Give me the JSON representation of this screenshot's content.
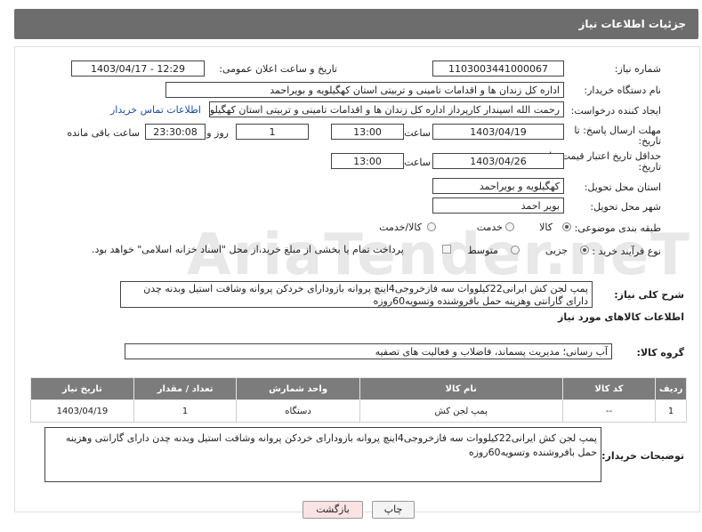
{
  "header": {
    "title": "جزئیات اطلاعات نیاز"
  },
  "form": {
    "need_number_label": "شماره نیاز:",
    "need_number": "1103003441000067",
    "announce_label": "تاریخ و ساعت اعلان عمومی:",
    "announce_value": "1403/04/17 - 12:29",
    "buyer_org_label": "نام دستگاه خریدار:",
    "buyer_org": "اداره کل زندان ها و اقدامات تامینی و تربیتی استان کهگیلویه و بویراحمد",
    "requester_label": "ایجاد کننده درخواست:",
    "requester": "رحمت الله اسپندار کارپرداز اداره کل زندان ها و اقدامات تامینی و تربیتی استان کهگیلویه و بویراحمد",
    "contact_link": "اطلاعات تماس خریدار",
    "reply_deadline_label": "مهلت ارسال پاسخ: تا",
    "reply_deadline_label2": "تاریخ:",
    "reply_date": "1403/04/19",
    "time_label": "ساعت",
    "reply_time": "13:00",
    "days_value": "1",
    "days_label": "روز و",
    "remaining_value": "23:30:08",
    "remaining_label": "ساعت باقی مانده",
    "validity_label": "حداقل تاریخ اعتبار قیمت: تا",
    "validity_label2": "تاریخ:",
    "validity_date": "1403/04/26",
    "validity_time": "13:00",
    "province_label": "استان محل تحویل:",
    "province": "کهگیلویه و بویراحمد",
    "city_label": "شهر محل تحویل:",
    "city": "بویر احمد",
    "category_label": "طبقه بندی موضوعی:",
    "cat_goods": "کالا",
    "cat_service": "خدمت",
    "cat_goods_service": "کالا/خدمت",
    "process_label": "نوع فرآیند خرید :",
    "proc_minor": "جزیی",
    "proc_medium": "متوسط",
    "payment_note": "پرداخت تمام یا بخشی از مبلغ خرید،از محل \"اسناد خزانه اسلامی\" خواهد بود."
  },
  "summary": {
    "label": "شرح کلی نیاز:",
    "text": "پمپ لجن کش ایرانی22کیلووات سه فازخروجی4اینچ پروانه بازودارای خردکن پروانه وشافت استیل وبدنه چدن دارای گارانتی وهزینه حمل بافروشنده وتسویه60روزه"
  },
  "goods": {
    "section_title": "اطلاعات کالاهای مورد نیاز",
    "group_label": "گروه کالا:",
    "group_value": "آب رسانی؛ مدیریت پسماند، فاضلاب و فعالیت های تصفیه",
    "columns": [
      "ردیف",
      "کد کالا",
      "نام کالا",
      "واحد شمارش",
      "تعداد / مقدار",
      "تاریخ نیاز"
    ],
    "rows": [
      {
        "row": "1",
        "code": "--",
        "name": "پمپ لجن کش",
        "unit": "دستگاه",
        "qty": "1",
        "date": "1403/04/19"
      }
    ]
  },
  "buyer_notes": {
    "label": "توضیحات خریدار:",
    "text": "پمپ لجن کش ایرانی22کیلووات سه فازخروجی4اینچ پروانه بازودارای خردکن پروانه وشافت استیل وبدنه چدن دارای گارانتی وهزینه حمل بافروشنده وتسویه60روزه"
  },
  "buttons": {
    "print": "چاپ",
    "back": "بازگشت"
  },
  "watermark": "AriaTender.neT",
  "colors": {
    "header_bg": "#6d6d6d",
    "table_header_bg": "#7c7c7c",
    "link": "#1a4fa8",
    "back_btn_bg": "#fbe3e3"
  }
}
